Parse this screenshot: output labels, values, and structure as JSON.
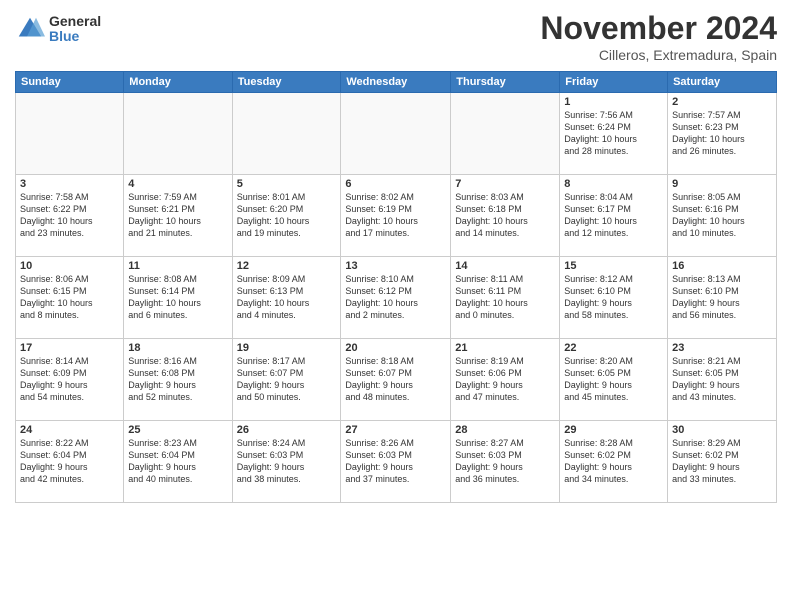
{
  "logo": {
    "general": "General",
    "blue": "Blue"
  },
  "title": "November 2024",
  "location": "Cilleros, Extremadura, Spain",
  "days_of_week": [
    "Sunday",
    "Monday",
    "Tuesday",
    "Wednesday",
    "Thursday",
    "Friday",
    "Saturday"
  ],
  "weeks": [
    [
      {
        "day": "",
        "info": ""
      },
      {
        "day": "",
        "info": ""
      },
      {
        "day": "",
        "info": ""
      },
      {
        "day": "",
        "info": ""
      },
      {
        "day": "",
        "info": ""
      },
      {
        "day": "1",
        "info": "Sunrise: 7:56 AM\nSunset: 6:24 PM\nDaylight: 10 hours\nand 28 minutes."
      },
      {
        "day": "2",
        "info": "Sunrise: 7:57 AM\nSunset: 6:23 PM\nDaylight: 10 hours\nand 26 minutes."
      }
    ],
    [
      {
        "day": "3",
        "info": "Sunrise: 7:58 AM\nSunset: 6:22 PM\nDaylight: 10 hours\nand 23 minutes."
      },
      {
        "day": "4",
        "info": "Sunrise: 7:59 AM\nSunset: 6:21 PM\nDaylight: 10 hours\nand 21 minutes."
      },
      {
        "day": "5",
        "info": "Sunrise: 8:01 AM\nSunset: 6:20 PM\nDaylight: 10 hours\nand 19 minutes."
      },
      {
        "day": "6",
        "info": "Sunrise: 8:02 AM\nSunset: 6:19 PM\nDaylight: 10 hours\nand 17 minutes."
      },
      {
        "day": "7",
        "info": "Sunrise: 8:03 AM\nSunset: 6:18 PM\nDaylight: 10 hours\nand 14 minutes."
      },
      {
        "day": "8",
        "info": "Sunrise: 8:04 AM\nSunset: 6:17 PM\nDaylight: 10 hours\nand 12 minutes."
      },
      {
        "day": "9",
        "info": "Sunrise: 8:05 AM\nSunset: 6:16 PM\nDaylight: 10 hours\nand 10 minutes."
      }
    ],
    [
      {
        "day": "10",
        "info": "Sunrise: 8:06 AM\nSunset: 6:15 PM\nDaylight: 10 hours\nand 8 minutes."
      },
      {
        "day": "11",
        "info": "Sunrise: 8:08 AM\nSunset: 6:14 PM\nDaylight: 10 hours\nand 6 minutes."
      },
      {
        "day": "12",
        "info": "Sunrise: 8:09 AM\nSunset: 6:13 PM\nDaylight: 10 hours\nand 4 minutes."
      },
      {
        "day": "13",
        "info": "Sunrise: 8:10 AM\nSunset: 6:12 PM\nDaylight: 10 hours\nand 2 minutes."
      },
      {
        "day": "14",
        "info": "Sunrise: 8:11 AM\nSunset: 6:11 PM\nDaylight: 10 hours\nand 0 minutes."
      },
      {
        "day": "15",
        "info": "Sunrise: 8:12 AM\nSunset: 6:10 PM\nDaylight: 9 hours\nand 58 minutes."
      },
      {
        "day": "16",
        "info": "Sunrise: 8:13 AM\nSunset: 6:10 PM\nDaylight: 9 hours\nand 56 minutes."
      }
    ],
    [
      {
        "day": "17",
        "info": "Sunrise: 8:14 AM\nSunset: 6:09 PM\nDaylight: 9 hours\nand 54 minutes."
      },
      {
        "day": "18",
        "info": "Sunrise: 8:16 AM\nSunset: 6:08 PM\nDaylight: 9 hours\nand 52 minutes."
      },
      {
        "day": "19",
        "info": "Sunrise: 8:17 AM\nSunset: 6:07 PM\nDaylight: 9 hours\nand 50 minutes."
      },
      {
        "day": "20",
        "info": "Sunrise: 8:18 AM\nSunset: 6:07 PM\nDaylight: 9 hours\nand 48 minutes."
      },
      {
        "day": "21",
        "info": "Sunrise: 8:19 AM\nSunset: 6:06 PM\nDaylight: 9 hours\nand 47 minutes."
      },
      {
        "day": "22",
        "info": "Sunrise: 8:20 AM\nSunset: 6:05 PM\nDaylight: 9 hours\nand 45 minutes."
      },
      {
        "day": "23",
        "info": "Sunrise: 8:21 AM\nSunset: 6:05 PM\nDaylight: 9 hours\nand 43 minutes."
      }
    ],
    [
      {
        "day": "24",
        "info": "Sunrise: 8:22 AM\nSunset: 6:04 PM\nDaylight: 9 hours\nand 42 minutes."
      },
      {
        "day": "25",
        "info": "Sunrise: 8:23 AM\nSunset: 6:04 PM\nDaylight: 9 hours\nand 40 minutes."
      },
      {
        "day": "26",
        "info": "Sunrise: 8:24 AM\nSunset: 6:03 PM\nDaylight: 9 hours\nand 38 minutes."
      },
      {
        "day": "27",
        "info": "Sunrise: 8:26 AM\nSunset: 6:03 PM\nDaylight: 9 hours\nand 37 minutes."
      },
      {
        "day": "28",
        "info": "Sunrise: 8:27 AM\nSunset: 6:03 PM\nDaylight: 9 hours\nand 36 minutes."
      },
      {
        "day": "29",
        "info": "Sunrise: 8:28 AM\nSunset: 6:02 PM\nDaylight: 9 hours\nand 34 minutes."
      },
      {
        "day": "30",
        "info": "Sunrise: 8:29 AM\nSunset: 6:02 PM\nDaylight: 9 hours\nand 33 minutes."
      }
    ]
  ]
}
